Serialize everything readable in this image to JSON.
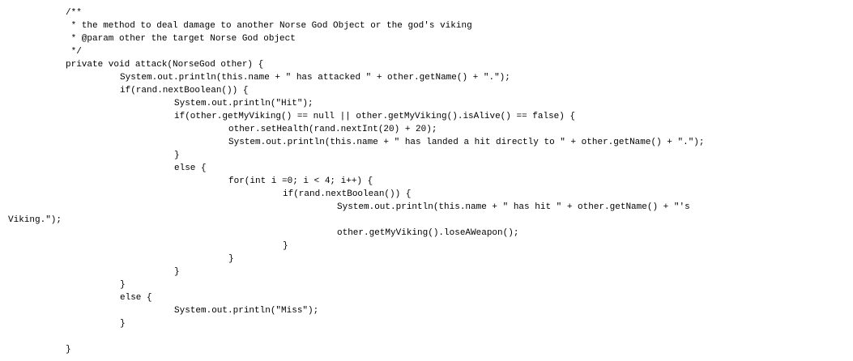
{
  "code": {
    "lines": [
      "/**",
      " * the method to deal damage to another Norse God Object or the god's viking",
      " * @param other the target Norse God object",
      " */",
      "private void attack(NorseGod other) {",
      "System.out.println(this.name + \" has attacked \" + other.getName() + \".\");",
      "if(rand.nextBoolean()) {",
      "System.out.println(\"Hit\");",
      "if(other.getMyViking() == null || other.getMyViking().isAlive() == false) {",
      "other.setHealth(rand.nextInt(20) + 20);",
      "System.out.println(this.name + \" has landed a hit directly to \" + other.getName() + \".\");",
      "}",
      "else {",
      "for(int i =0; i < 4; i++) {",
      "if(rand.nextBoolean()) {",
      "System.out.println(this.name + \" has hit \" + other.getName() + \"'s",
      "Viking.\");",
      "other.getMyViking().loseAWeapon();",
      "}",
      "}",
      "}",
      "}",
      "else {",
      "System.out.println(\"Miss\");",
      "}",
      "}"
    ]
  }
}
